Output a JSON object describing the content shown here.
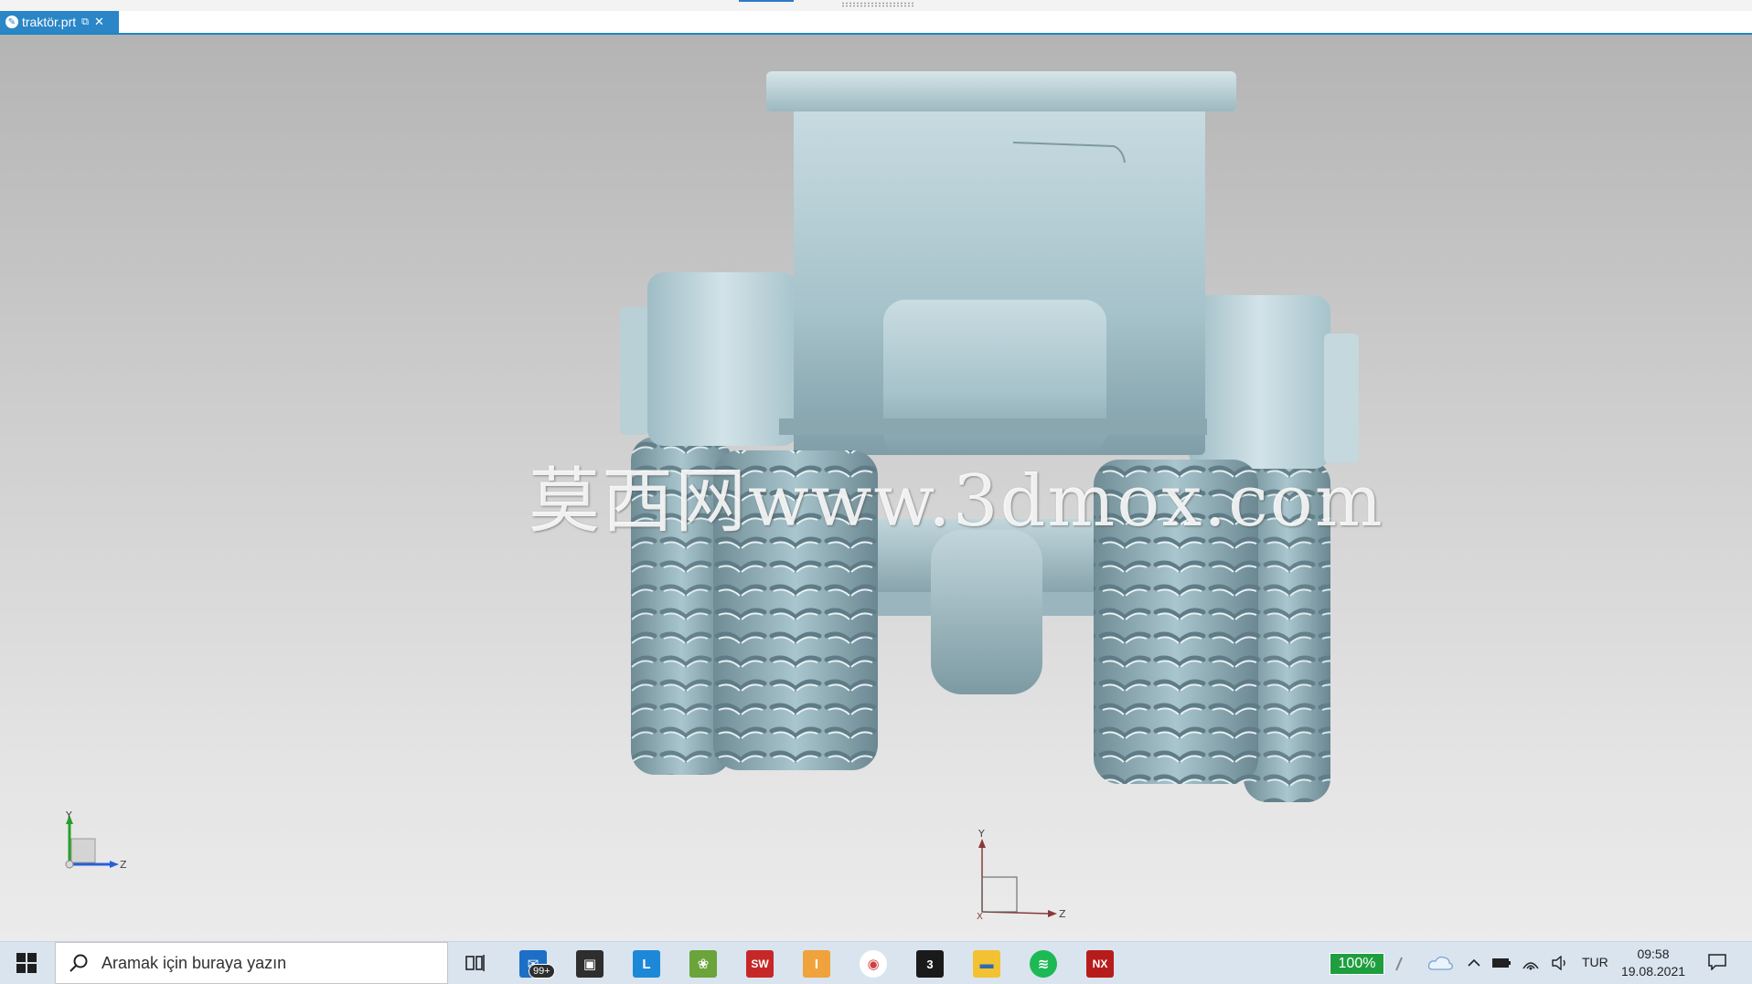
{
  "tab": {
    "filename": "traktör.prt"
  },
  "viewport": {
    "watermark": "莫西网www.3dmox.com",
    "corner_triad": {
      "y_label": "Y",
      "z_label": "Z"
    },
    "center_triad": {
      "y_label": "Y",
      "z_label": "Z",
      "x_label": "X"
    }
  },
  "taskbar": {
    "search_placeholder": "Aramak için buraya yazın",
    "mail_badge": "99+",
    "apps": [
      "task-view",
      "mail",
      "store",
      "lightshot",
      "fruit-app",
      "solidworks",
      "inventor",
      "browser",
      "3dsmax",
      "file-explorer",
      "spotify",
      "nx"
    ],
    "battery_percent": "100%",
    "language": "TUR",
    "time": "09:58",
    "date": "19.08.2021"
  },
  "colors": {
    "tab_active": "#2a86c6",
    "model_surface": "#a9c4cc",
    "taskbar_bg": "#d9e4ef",
    "battery_badge": "#1e9e3e"
  }
}
